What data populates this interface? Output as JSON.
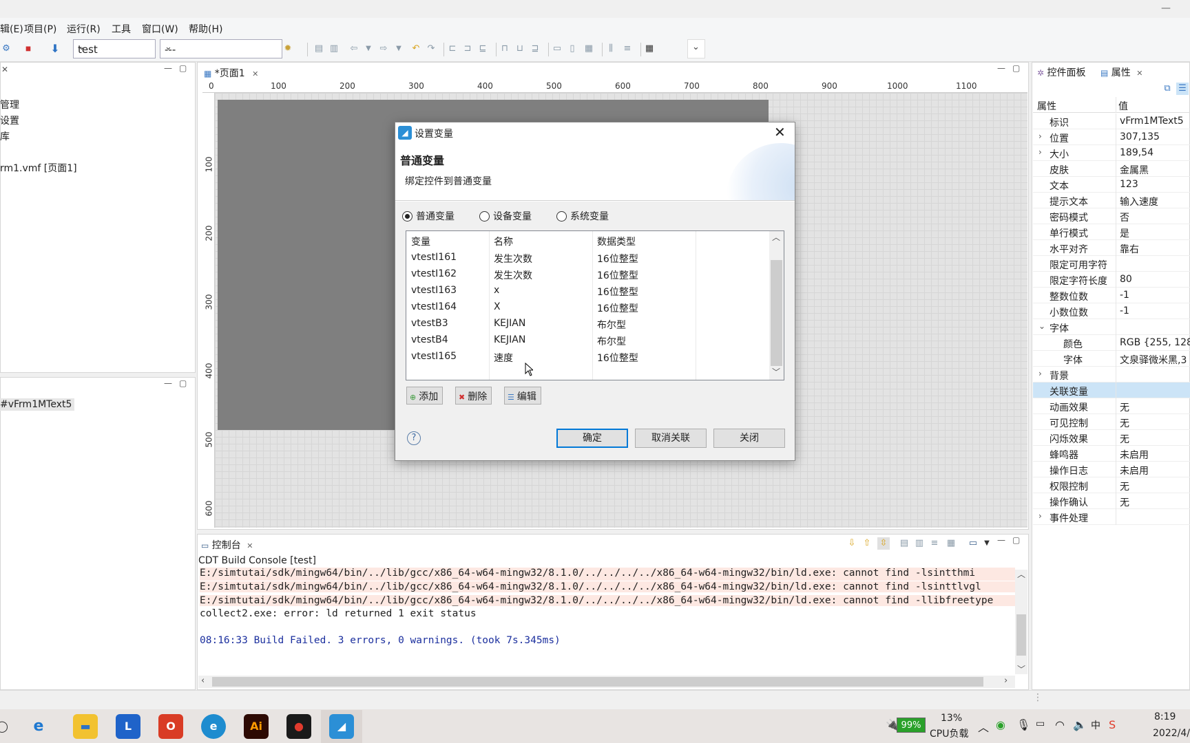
{
  "menu": [
    "辑(E)",
    "项目(P)",
    "运行(R)",
    "工具",
    "窗口(W)",
    "帮助(H)"
  ],
  "toolbar": {
    "project_combo": "test",
    "page_combo": "---"
  },
  "left_tree": {
    "items": [
      "管理",
      "设置",
      "库",
      "rm1.vmf [页面1]"
    ]
  },
  "left_outline": {
    "item": "#vFrm1MText5"
  },
  "editor": {
    "tab": "*页面1",
    "ruler_x": [
      "0",
      "100",
      "200",
      "300",
      "400",
      "500",
      "600",
      "700",
      "800",
      "900",
      "1000",
      "1100"
    ],
    "ruler_y": [
      "100",
      "200",
      "300",
      "400",
      "500",
      "600"
    ]
  },
  "console": {
    "tab": "控制台",
    "subtitle": "CDT Build Console [test]",
    "lines": [
      "E:/simtutai/sdk/mingw64/bin/../lib/gcc/x86_64-w64-mingw32/8.1.0/../../../../x86_64-w64-mingw32/bin/ld.exe: cannot find -lsintthmi",
      "E:/simtutai/sdk/mingw64/bin/../lib/gcc/x86_64-w64-mingw32/8.1.0/../../../../x86_64-w64-mingw32/bin/ld.exe: cannot find -lsinttlvgl",
      "E:/simtutai/sdk/mingw64/bin/../lib/gcc/x86_64-w64-mingw32/8.1.0/../../../../x86_64-w64-mingw32/bin/ld.exe: cannot find -llibfreetype",
      "collect2.exe: error: ld returned 1 exit status",
      "08:16:33 Build Failed. 3 errors, 0 warnings. (took 7s.345ms)"
    ]
  },
  "properties": {
    "tab_palette": "控件面板",
    "tab_props": "属性",
    "header_key": "属性",
    "header_val": "值",
    "rows": [
      {
        "k": "标识",
        "v": "vFrm1MText5"
      },
      {
        "k": "位置",
        "v": "307,135"
      },
      {
        "k": "大小",
        "v": "189,54"
      },
      {
        "k": "皮肤",
        "v": "金属黑"
      },
      {
        "k": "文本",
        "v": "123"
      },
      {
        "k": "提示文本",
        "v": "输入速度"
      },
      {
        "k": "密码模式",
        "v": "否"
      },
      {
        "k": "单行模式",
        "v": "是"
      },
      {
        "k": "水平对齐",
        "v": "靠右"
      },
      {
        "k": "限定可用字符",
        "v": ""
      },
      {
        "k": "限定字符长度",
        "v": "80"
      },
      {
        "k": "整数位数",
        "v": "-1"
      },
      {
        "k": "小数位数",
        "v": "-1"
      },
      {
        "k": "字体",
        "v": ""
      },
      {
        "k": "颜色",
        "v": "RGB {255, 128,"
      },
      {
        "k": "字体",
        "v": "文泉驿微米黑,3"
      },
      {
        "k": "背景",
        "v": ""
      },
      {
        "k": "关联变量",
        "v": ""
      },
      {
        "k": "动画效果",
        "v": "无"
      },
      {
        "k": "可见控制",
        "v": "无"
      },
      {
        "k": "闪烁效果",
        "v": "无"
      },
      {
        "k": "蜂鸣器",
        "v": "未启用"
      },
      {
        "k": "操作日志",
        "v": "未启用"
      },
      {
        "k": "权限控制",
        "v": "无"
      },
      {
        "k": "操作确认",
        "v": "无"
      },
      {
        "k": "事件处理",
        "v": ""
      }
    ]
  },
  "dialog": {
    "title": "设置变量",
    "heading": "普通变量",
    "description": "绑定控件到普通变量",
    "radios": [
      "普通变量",
      "设备变量",
      "系统变量"
    ],
    "columns": [
      "变量",
      "名称",
      "数据类型"
    ],
    "rows": [
      [
        "vtestI161",
        "发生次数",
        "16位整型"
      ],
      [
        "vtestI162",
        "发生次数",
        "16位整型"
      ],
      [
        "vtestI163",
        "x",
        "16位整型"
      ],
      [
        "vtestI164",
        "X",
        "16位整型"
      ],
      [
        "vtestB3",
        "KEJIAN",
        "布尔型"
      ],
      [
        "vtestB4",
        "KEJIAN",
        "布尔型"
      ],
      [
        "vtestI165",
        "速度",
        "16位整型"
      ]
    ],
    "add": "添加",
    "delete": "删除",
    "edit": "编辑",
    "ok": "确定",
    "unbind": "取消关联",
    "close": "关闭"
  },
  "taskbar": {
    "battery": "99%",
    "cpu_percent": "13%",
    "cpu_label": "CPU负载",
    "time": "8:19",
    "date": "2022/4/"
  }
}
